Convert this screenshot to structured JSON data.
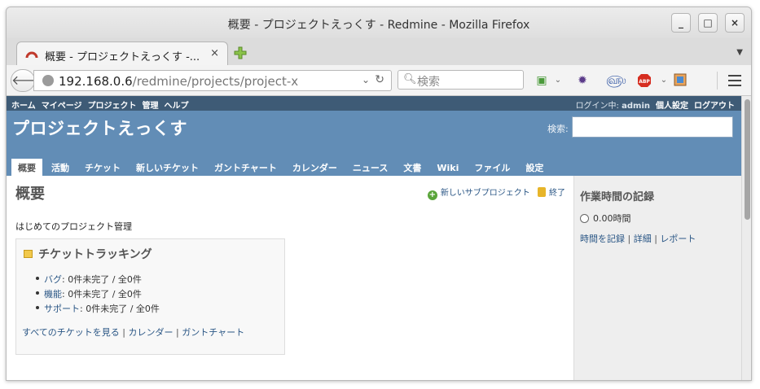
{
  "window": {
    "title": "概要 - プロジェクトえっくす - Redmine - Mozilla Firefox",
    "minimize": "_",
    "maximize": "□",
    "close": "×"
  },
  "tab": {
    "title": "概要 - プロジェクトえっくす -...",
    "close": "×"
  },
  "navbar": {
    "url_host": "192.168.0.6",
    "url_path": "/redmine/projects/project-x",
    "search_placeholder": "検索"
  },
  "topmenu": {
    "items": [
      "ホーム",
      "マイページ",
      "プロジェクト",
      "管理",
      "ヘルプ"
    ],
    "logged_as_label": "ログイン中:",
    "user": "admin",
    "my_account": "個人設定",
    "logout": "ログアウト"
  },
  "header": {
    "project_title": "プロジェクトえっくす",
    "search_label": "検索:"
  },
  "main_menu": [
    {
      "label": "概要",
      "selected": true
    },
    {
      "label": "活動"
    },
    {
      "label": "チケット"
    },
    {
      "label": "新しいチケット"
    },
    {
      "label": "ガントチャート"
    },
    {
      "label": "カレンダー"
    },
    {
      "label": "ニュース"
    },
    {
      "label": "文書"
    },
    {
      "label": "Wiki"
    },
    {
      "label": "ファイル"
    },
    {
      "label": "設定"
    }
  ],
  "content": {
    "heading": "概要",
    "new_subproject": "新しいサブプロジェクト",
    "close_project": "終了",
    "description": "はじめてのプロジェクト管理",
    "issue_tracking": {
      "title": "チケットトラッキング",
      "trackers": [
        {
          "name": "バグ",
          "stats": ": 0件未完了 / 全0件"
        },
        {
          "name": "機能",
          "stats": ": 0件未完了 / 全0件"
        },
        {
          "name": "サポート",
          "stats": ": 0件未完了 / 全0件"
        }
      ],
      "view_all": "すべてのチケットを見る",
      "calendar": "カレンダー",
      "gantt": "ガントチャート",
      "sep": " | "
    }
  },
  "sidebar": {
    "title": "作業時間の記録",
    "hours": "0.00時間",
    "log_time": "時間を記録",
    "details": "詳細",
    "report": "レポート",
    "sep": " | "
  },
  "colors": {
    "header": "#628db6",
    "topmenu": "#3e5b76",
    "link": "#2a5685"
  }
}
